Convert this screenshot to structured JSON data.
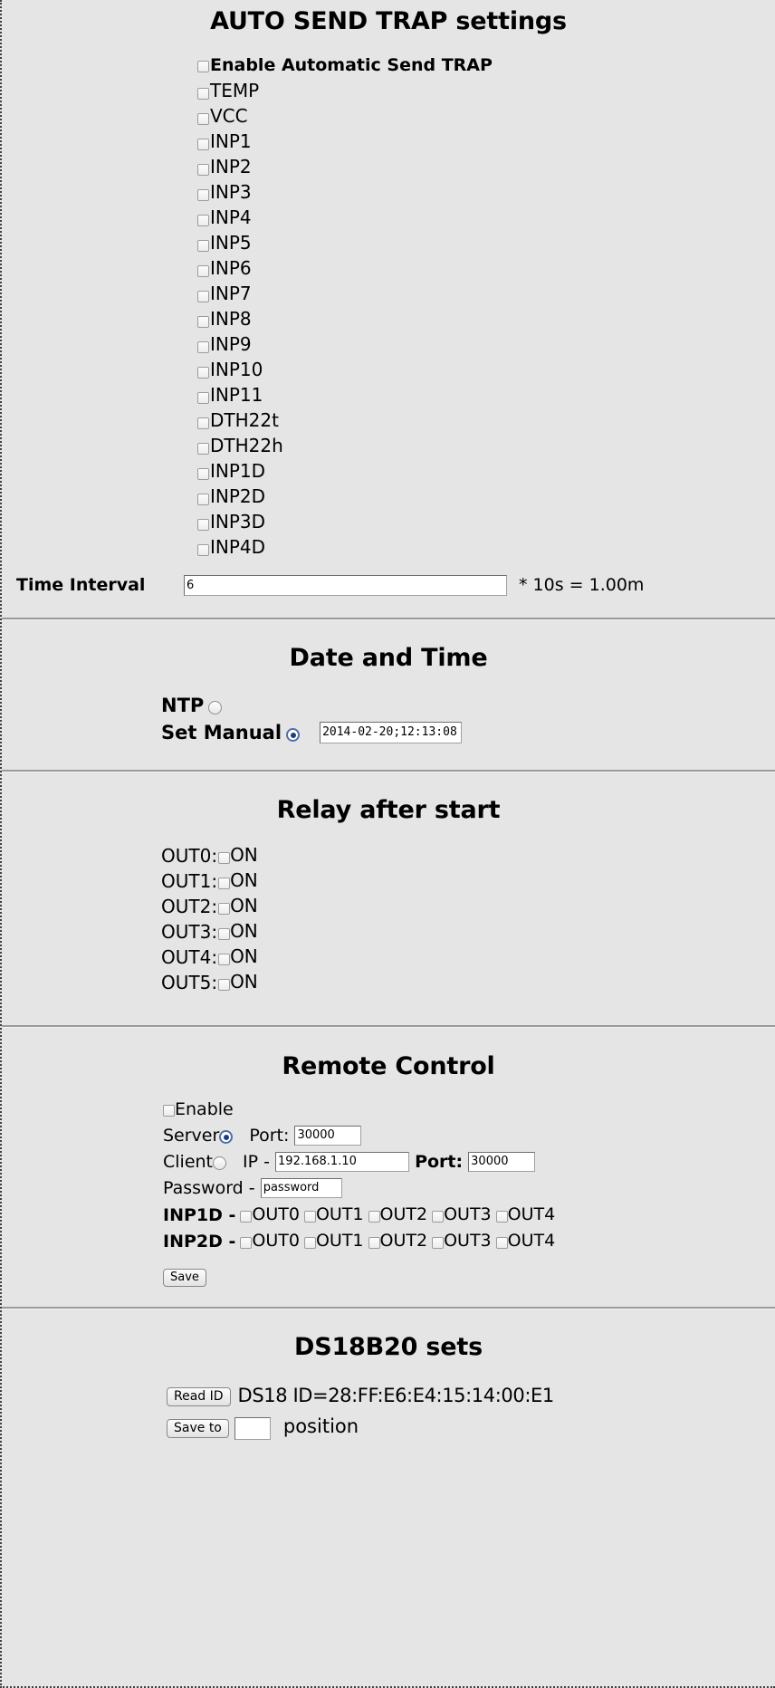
{
  "sections": {
    "trap": {
      "heading": "AUTO SEND TRAP settings",
      "items": [
        {
          "label": "Enable Automatic Send TRAP",
          "checked": false,
          "bold": true
        },
        {
          "label": "TEMP",
          "checked": false
        },
        {
          "label": "VCC",
          "checked": false
        },
        {
          "label": "INP1",
          "checked": false
        },
        {
          "label": "INP2",
          "checked": false
        },
        {
          "label": "INP3",
          "checked": false
        },
        {
          "label": "INP4",
          "checked": false
        },
        {
          "label": "INP5",
          "checked": false
        },
        {
          "label": "INP6",
          "checked": false
        },
        {
          "label": "INP7",
          "checked": false
        },
        {
          "label": "INP8",
          "checked": false
        },
        {
          "label": "INP9",
          "checked": false
        },
        {
          "label": "INP10",
          "checked": false
        },
        {
          "label": "INP11",
          "checked": false
        },
        {
          "label": "DTH22t",
          "checked": false
        },
        {
          "label": "DTH22h",
          "checked": false
        },
        {
          "label": "INP1D",
          "checked": false
        },
        {
          "label": "INP2D",
          "checked": false
        },
        {
          "label": "INP3D",
          "checked": false
        },
        {
          "label": "INP4D",
          "checked": false
        }
      ],
      "interval_label": "Time Interval",
      "interval_value": "6",
      "interval_suffix": "* 10s = 1.00m"
    },
    "datetime": {
      "heading": "Date and Time",
      "ntp_label": "NTP",
      "ntp_selected": false,
      "manual_label": "Set Manual",
      "manual_selected": true,
      "datetime_value": "2014-02-20;12:13:08"
    },
    "relay": {
      "heading": "Relay after start",
      "on_label": "ON",
      "outputs": [
        {
          "label": "OUT0:",
          "checked": false
        },
        {
          "label": "OUT1:",
          "checked": false
        },
        {
          "label": "OUT2:",
          "checked": false
        },
        {
          "label": "OUT3:",
          "checked": false
        },
        {
          "label": "OUT4:",
          "checked": false
        },
        {
          "label": "OUT5:",
          "checked": false
        }
      ]
    },
    "remote": {
      "heading": "Remote Control",
      "enable_label": "Enable",
      "enable_checked": false,
      "server_label": "Server",
      "server_selected": true,
      "server_port_label": "Port:",
      "server_port_value": "30000",
      "client_label": "Client",
      "client_selected": false,
      "client_ip_label": "IP -",
      "client_ip_value": "192.168.1.10",
      "client_port_label": "Port:",
      "client_port_value": "30000",
      "password_label": "Password -",
      "password_value": "password",
      "inp1d_label": "INP1D -",
      "inp2d_label": "INP2D -",
      "out_options": [
        "OUT0",
        "OUT1",
        "OUT2",
        "OUT3",
        "OUT4"
      ],
      "save_label": "Save"
    },
    "ds18b20": {
      "heading": "DS18B20 sets",
      "read_id_label": "Read ID",
      "ds_id_text": "DS18 ID=28:FF:E6:E4:15:14:00:E1",
      "save_to_label": "Save to",
      "position_value": "",
      "position_label": "position"
    }
  },
  "colors": {
    "background": "#e5e5e5",
    "text": "#000000",
    "rule": "#9a9a9a",
    "radio_accent": "#1c3f7a",
    "input_background": "#ffffff"
  }
}
